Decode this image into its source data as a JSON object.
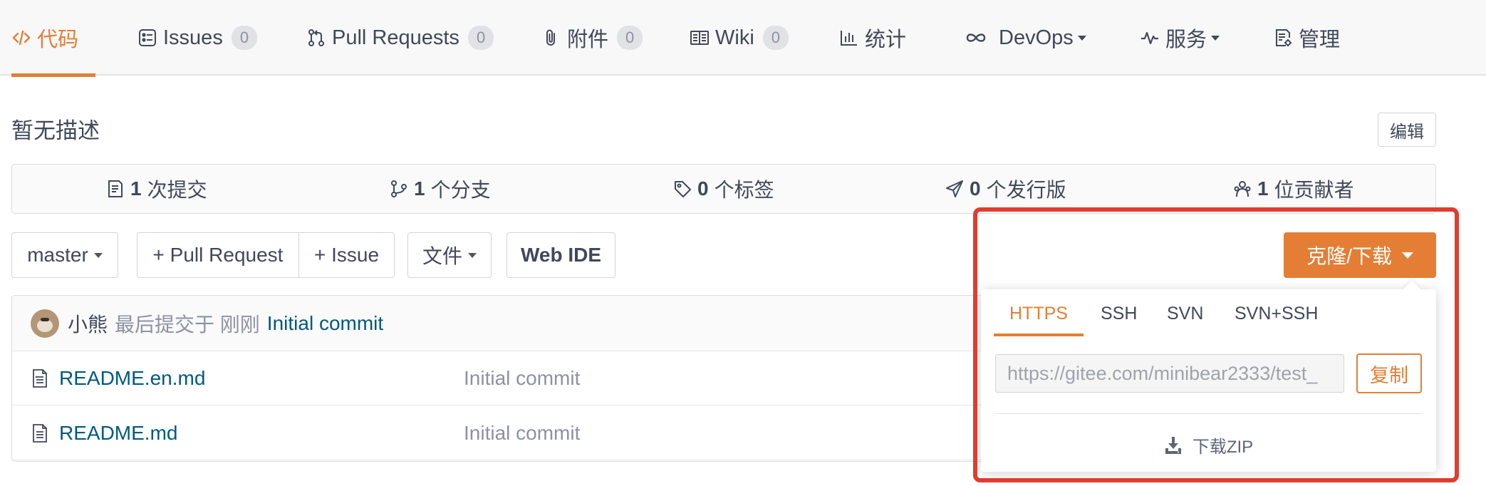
{
  "nav": {
    "tabs": [
      {
        "label": "代码",
        "icon": "code-icon",
        "active": true
      },
      {
        "label": "Issues",
        "icon": "issues-icon",
        "count": "0"
      },
      {
        "label": "Pull Requests",
        "icon": "pull-request-icon",
        "count": "0"
      },
      {
        "label": "附件",
        "icon": "paperclip-icon",
        "count": "0"
      },
      {
        "label": "Wiki",
        "icon": "book-icon",
        "count": "0"
      },
      {
        "label": "统计",
        "icon": "bar-chart-icon"
      },
      {
        "label": "DevOps",
        "icon": "infinity-icon",
        "dropdown": true
      },
      {
        "label": "服务",
        "icon": "pulse-icon",
        "dropdown": true
      },
      {
        "label": "管理",
        "icon": "settings-doc-icon"
      }
    ]
  },
  "repo": {
    "description": "暂无描述",
    "edit_label": "编辑"
  },
  "stats": [
    {
      "value": "1",
      "label": "次提交",
      "icon": "commit-doc-icon"
    },
    {
      "value": "1",
      "label": "个分支",
      "icon": "branch-icon"
    },
    {
      "value": "0",
      "label": "个标签",
      "icon": "tag-icon"
    },
    {
      "value": "0",
      "label": "个发行版",
      "icon": "release-icon"
    },
    {
      "value": "1",
      "label": "位贡献者",
      "icon": "contributors-icon"
    }
  ],
  "toolbar": {
    "branch": "master",
    "pull_request": "+ Pull Request",
    "issue": "+ Issue",
    "file": "文件",
    "web_ide": "Web IDE",
    "clone": "克隆/下载"
  },
  "latest_commit": {
    "author": "小熊",
    "meta": "最后提交于 刚刚",
    "message": "Initial commit"
  },
  "files": [
    {
      "name": "README.en.md",
      "message": "Initial commit",
      "icon": "file-icon"
    },
    {
      "name": "README.md",
      "message": "Initial commit",
      "icon": "file-icon"
    }
  ],
  "clone_panel": {
    "tabs": [
      "HTTPS",
      "SSH",
      "SVN",
      "SVN+SSH"
    ],
    "active_tab": "HTTPS",
    "url": "https://gitee.com/minibear2333/test_",
    "copy_label": "复制",
    "download_label": "下载ZIP"
  },
  "colors": {
    "accent": "#e47e35",
    "link": "#005980",
    "highlight": "#e03c2f"
  }
}
